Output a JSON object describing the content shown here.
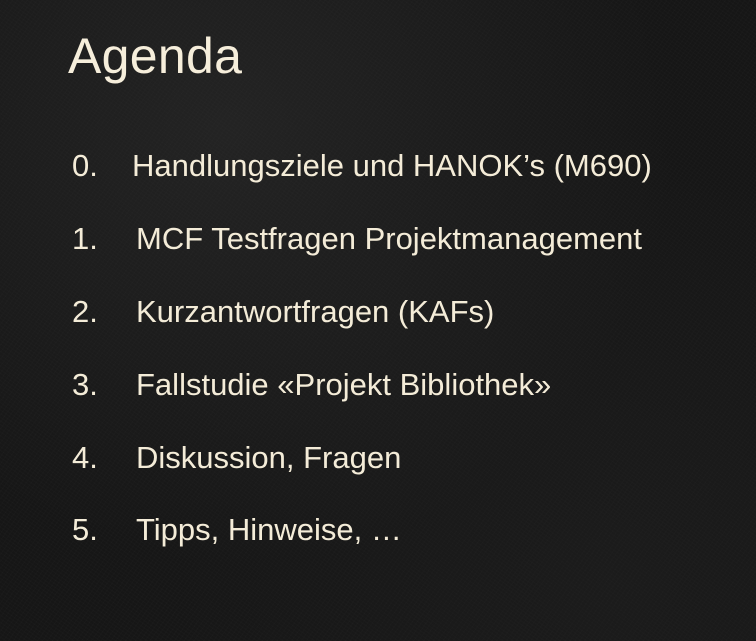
{
  "slide": {
    "title": "Agenda",
    "items": [
      {
        "number": "0.",
        "text": "Handlungsziele und HANOK’s (M690)"
      },
      {
        "number": "1.",
        "text": "MCF Testfragen Projektmanagement"
      },
      {
        "number": "2.",
        "text": "Kurzantwortfragen (KAFs)"
      },
      {
        "number": "3.",
        "text": "Fallstudie «Projekt Bibliothek»"
      },
      {
        "number": "4.",
        "text": "Diskussion, Fragen"
      },
      {
        "number": "5.",
        "text": "Tipps, Hinweise, …"
      }
    ]
  },
  "colors": {
    "background": "#161616",
    "text": "#f4ecd8"
  }
}
